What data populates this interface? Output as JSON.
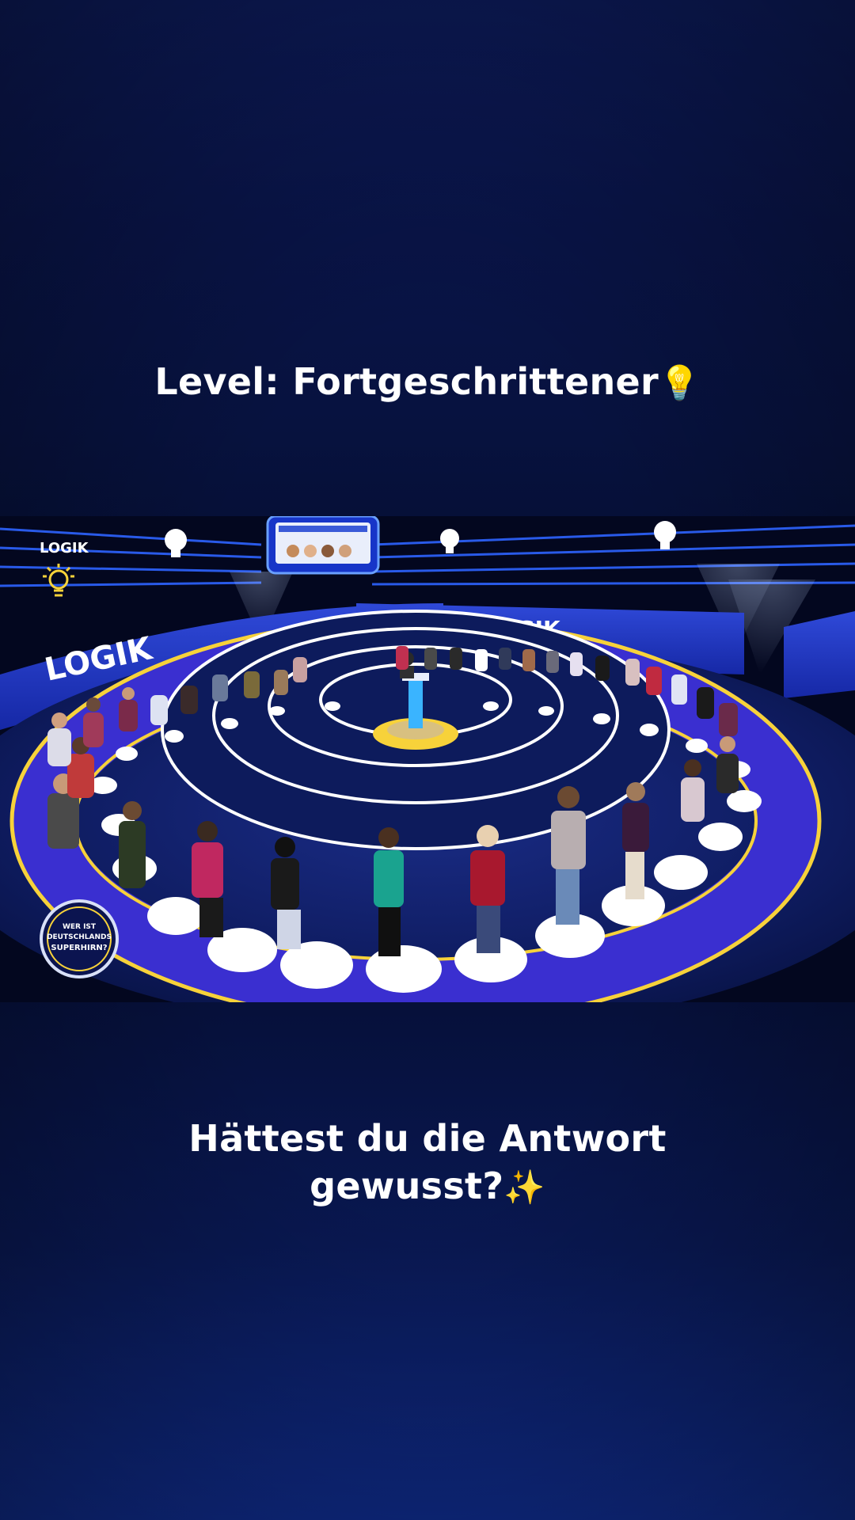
{
  "top_caption": {
    "text": "Level: Fortgeschrittener",
    "emoji": "💡"
  },
  "bottom_caption": {
    "line1": "Hättest du die Antwort",
    "line2": "gewusst?",
    "emoji": "✨"
  },
  "video": {
    "corner_label": "LOGIK",
    "wall_label_left": "LOGIK",
    "wall_label_center": "LOGIK",
    "show_logo": {
      "line1": "WER IST",
      "line2": "DEUTSCHLANDS",
      "line3": "SUPERHIRN?"
    }
  },
  "colors": {
    "accent_yellow": "#f7d23a",
    "stage_blue": "#2a3cd6",
    "floor_navy": "#0f1e62"
  }
}
